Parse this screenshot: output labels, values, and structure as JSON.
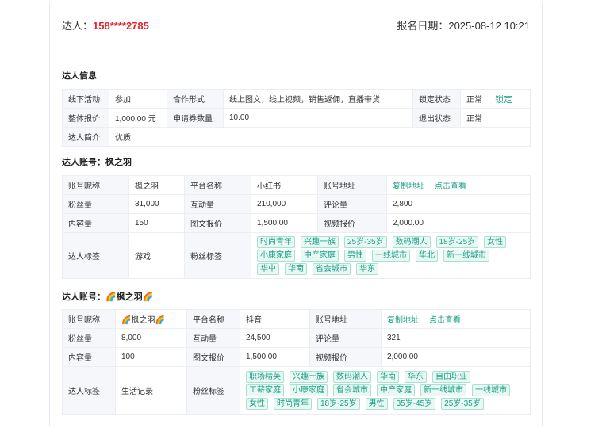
{
  "header": {
    "talent_label": "达人：",
    "phone": "158****2785",
    "signup_label": "报名日期：",
    "signup_date": "2025-08-12 10:21"
  },
  "talent_info": {
    "title": "达人信息",
    "offline_activity_label": "线下活动",
    "offline_activity": "参加",
    "cooperation_label": "合作形式",
    "cooperation": "线上图文，线上视频，销售返佣，直播带货",
    "lock_status_label": "锁定状态",
    "lock_status": "正常",
    "lock_action": "锁定",
    "total_price_label": "整体报价",
    "total_price": "1,000.00 元",
    "coupon_count_label": "申请券数量",
    "coupon_count": "10.00",
    "exit_status_label": "退出状态",
    "exit_status": "正常",
    "intro_label": "达人简介",
    "intro": "优质"
  },
  "account_labels": {
    "nickname": "账号昵称",
    "platform": "平台名称",
    "address": "账号地址",
    "copy_address": "复制地址",
    "view": "点击查看",
    "fans": "粉丝量",
    "interactions": "互动量",
    "comments": "评论量",
    "contents": "内容量",
    "image_price": "图文报价",
    "video_price": "视频报价",
    "talent_tags": "达人标签",
    "fan_tags": "粉丝标签"
  },
  "accounts": [
    {
      "title": "达人账号：枫之羽",
      "nickname": "枫之羽",
      "platform": "小红书",
      "fans": "31,000",
      "interactions": "210,000",
      "comments": "2,800",
      "contents": "150",
      "image_price": "1,500.00",
      "video_price": "2,000.00",
      "talent_tag": "游戏",
      "fan_tags": [
        "时尚青年",
        "兴趣一族",
        "25岁-35岁",
        "数码潮人",
        "18岁-25岁",
        "女性",
        "小康家庭",
        "中产家庭",
        "男性",
        "一线城市",
        "华北",
        "新一线城市",
        "华中",
        "华南",
        "省会城市",
        "华东"
      ]
    },
    {
      "title": "达人账号：🌈枫之羽🌈",
      "nickname": "🌈枫之羽🌈",
      "platform": "抖音",
      "fans": "8,000",
      "interactions": "24,500",
      "comments": "321",
      "contents": "100",
      "image_price": "1,500.00",
      "video_price": "2,000.00",
      "talent_tag": "生活记录",
      "fan_tags": [
        "职场精英",
        "兴趣一族",
        "数码潮人",
        "华南",
        "华东",
        "自由职业",
        "工薪家庭",
        "小康家庭",
        "省会城市",
        "中产家庭",
        "新一线城市",
        "一线城市",
        "女性",
        "时尚青年",
        "18岁-25岁",
        "男性",
        "35岁-45岁",
        "25岁-35岁"
      ]
    }
  ],
  "colors": {
    "accent": "#17a086",
    "phone": "#e3242b",
    "tag_background": "#e9f8f3",
    "tag_border": "#a8e2d2"
  }
}
